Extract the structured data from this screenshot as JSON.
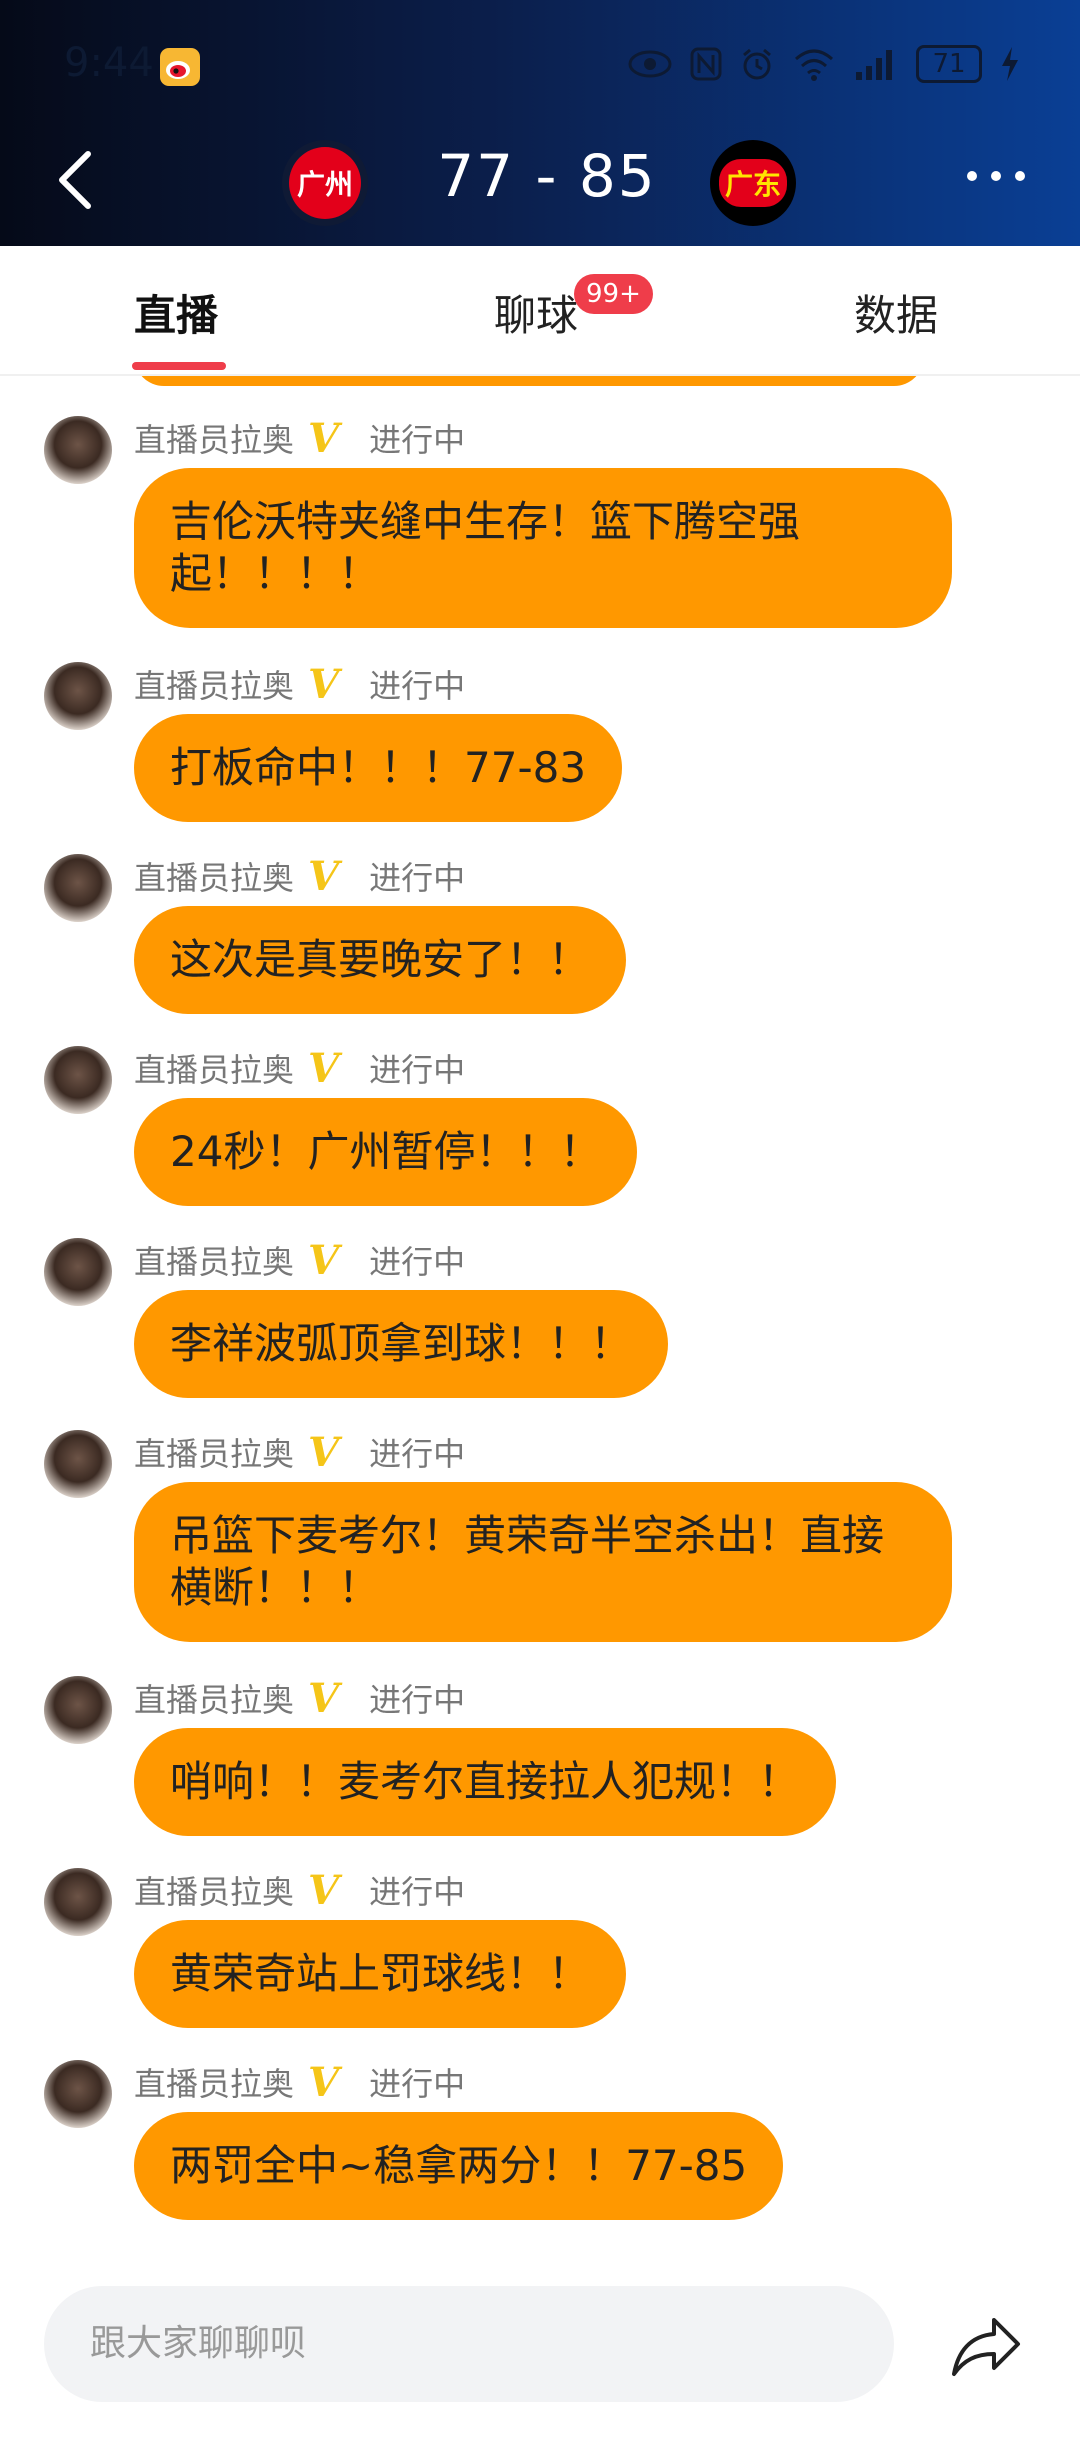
{
  "status_bar": {
    "time": "9:44",
    "battery": "71"
  },
  "match": {
    "home_team": "广州",
    "away_team": "广东",
    "score_home": "77",
    "score_sep": "-",
    "score_away": "85",
    "colors": {
      "home": "#e3001a",
      "away_text": "#ffe600",
      "header_end": "#0a3f95"
    }
  },
  "tabs": [
    {
      "label": "直播",
      "active": true
    },
    {
      "label": "聊球",
      "badge": "99+"
    },
    {
      "label": "数据"
    }
  ],
  "feed": {
    "messages": [
      {
        "author": "直播员拉奥",
        "status": "进行中",
        "text": "吉伦沃特夹缝中生存！篮下腾空强起！！！！"
      },
      {
        "author": "直播员拉奥",
        "status": "进行中",
        "text": "打板命中！！！77-83"
      },
      {
        "author": "直播员拉奥",
        "status": "进行中",
        "text": "这次是真要晚安了！！"
      },
      {
        "author": "直播员拉奥",
        "status": "进行中",
        "text": "24秒！广州暂停！！！"
      },
      {
        "author": "直播员拉奥",
        "status": "进行中",
        "text": "李祥波弧顶拿到球！！！"
      },
      {
        "author": "直播员拉奥",
        "status": "进行中",
        "text": "吊篮下麦考尔！黄荣奇半空杀出！直接横断！！！"
      },
      {
        "author": "直播员拉奥",
        "status": "进行中",
        "text": "哨响！！麦考尔直接拉人犯规！！"
      },
      {
        "author": "直播员拉奥",
        "status": "进行中",
        "text": "黄荣奇站上罚球线！！"
      },
      {
        "author": "直播员拉奥",
        "status": "进行中",
        "text": "两罚全中~稳拿两分！！77-85"
      }
    ],
    "verified_icon": "v-verified-icon",
    "bubble_color": "#ff9800"
  },
  "composer": {
    "placeholder": "跟大家聊聊呗",
    "share_icon": "share-icon"
  }
}
